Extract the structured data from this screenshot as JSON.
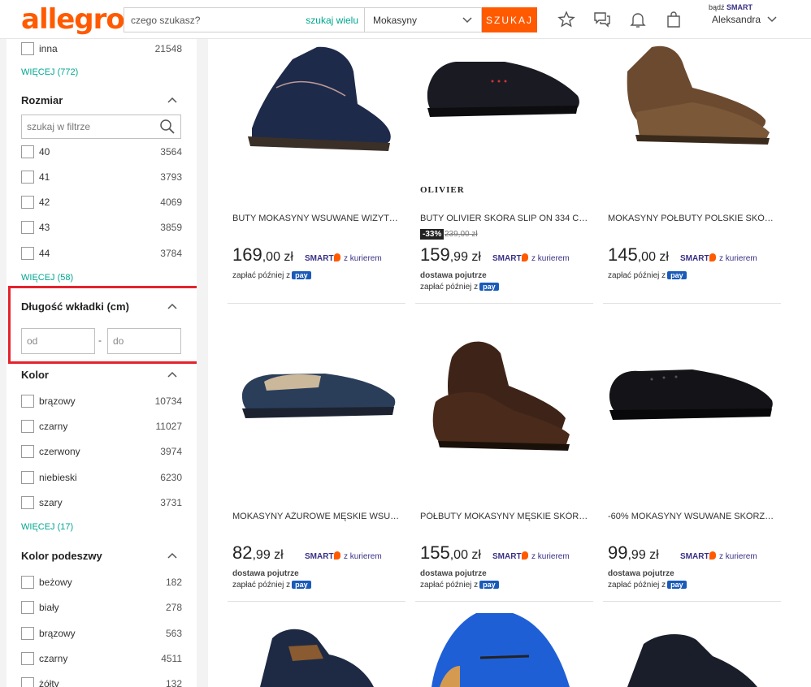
{
  "header": {
    "logo": "allegro",
    "search_placeholder": "czego szukasz?",
    "search_many": "szukaj wielu",
    "category": "Mokasyny",
    "search_button": "SZUKAJ",
    "smart_prefix": "bądź",
    "smart_label": "SMART",
    "user_name": "Aleksandra"
  },
  "sidebar": {
    "top_row": {
      "label": "inna",
      "count": "21548"
    },
    "top_more": "WIĘCEJ (772)",
    "size": {
      "title": "Rozmiar",
      "search_placeholder": "szukaj w filtrze",
      "items": [
        {
          "label": "40",
          "count": "3564"
        },
        {
          "label": "41",
          "count": "3793"
        },
        {
          "label": "42",
          "count": "4069"
        },
        {
          "label": "43",
          "count": "3859"
        },
        {
          "label": "44",
          "count": "3784"
        }
      ],
      "more": "WIĘCEJ (58)"
    },
    "insole": {
      "title": "Długość wkładki (cm)",
      "from_placeholder": "od",
      "to_placeholder": "do",
      "dash": "-"
    },
    "color": {
      "title": "Kolor",
      "items": [
        {
          "label": "brązowy",
          "count": "10734"
        },
        {
          "label": "czarny",
          "count": "11027"
        },
        {
          "label": "czerwony",
          "count": "3974"
        },
        {
          "label": "niebieski",
          "count": "6230"
        },
        {
          "label": "szary",
          "count": "3731"
        }
      ],
      "more": "WIĘCEJ (17)"
    },
    "sole": {
      "title": "Kolor podeszwy",
      "items": [
        {
          "label": "beżowy",
          "count": "182"
        },
        {
          "label": "biały",
          "count": "278"
        },
        {
          "label": "brązowy",
          "count": "563"
        },
        {
          "label": "czarny",
          "count": "4511"
        },
        {
          "label": "żółty",
          "count": "132"
        }
      ]
    }
  },
  "products": [
    {
      "title": "BUTY MOKASYNY WSUWANE WIZYTO...",
      "price_main": "169",
      "price_cents": ",00 zł",
      "smart": "SMART",
      "courier": "z kurierem",
      "pay_later": "zapłać później z",
      "pay": "pay"
    },
    {
      "brand": "OLIVIER",
      "title": "BUTY OLIVIER SKÓRA SLIP ON 334 CZA...",
      "discount": "-33%",
      "old_price": "239,00 zł",
      "price_main": "159",
      "price_cents": ",99 zł",
      "smart": "SMART",
      "courier": "z kurierem",
      "delivery": "dostawa pojutrze",
      "pay_later": "zapłać później z",
      "pay": "pay"
    },
    {
      "title": "MOKASYNY PÓŁBUTY POLSKIE SKÓRA ...",
      "price_main": "145",
      "price_cents": ",00 zł",
      "smart": "SMART",
      "courier": "z kurierem",
      "pay_later": "zapłać później z",
      "pay": "pay"
    },
    {
      "title": "MOKASYNY AŻUROWE MĘSKIE WSUW...",
      "price_main": "82",
      "price_cents": ",99 zł",
      "smart": "SMART",
      "courier": "z kurierem",
      "delivery": "dostawa pojutrze",
      "pay_later": "zapłać później z",
      "pay": "pay"
    },
    {
      "title": "PÓŁBUTY MOKASYNY MĘSKIE SKÓRA ...",
      "price_main": "155",
      "price_cents": ",00 zł",
      "smart": "SMART",
      "courier": "z kurierem",
      "delivery": "dostawa pojutrze",
      "pay_later": "zapłać później z",
      "pay": "pay"
    },
    {
      "title": "-60% MOKASYNY WSUWANE SKÓRZAN...",
      "price_main": "99",
      "price_cents": ",99 zł",
      "smart": "SMART",
      "courier": "z kurierem",
      "delivery": "dostawa pojutrze",
      "pay_later": "zapłać później z",
      "pay": "pay"
    }
  ],
  "colors": {
    "accent": "#ff5a00",
    "link": "#00a790",
    "smart": "#393185",
    "highlight": "#e4232d"
  }
}
